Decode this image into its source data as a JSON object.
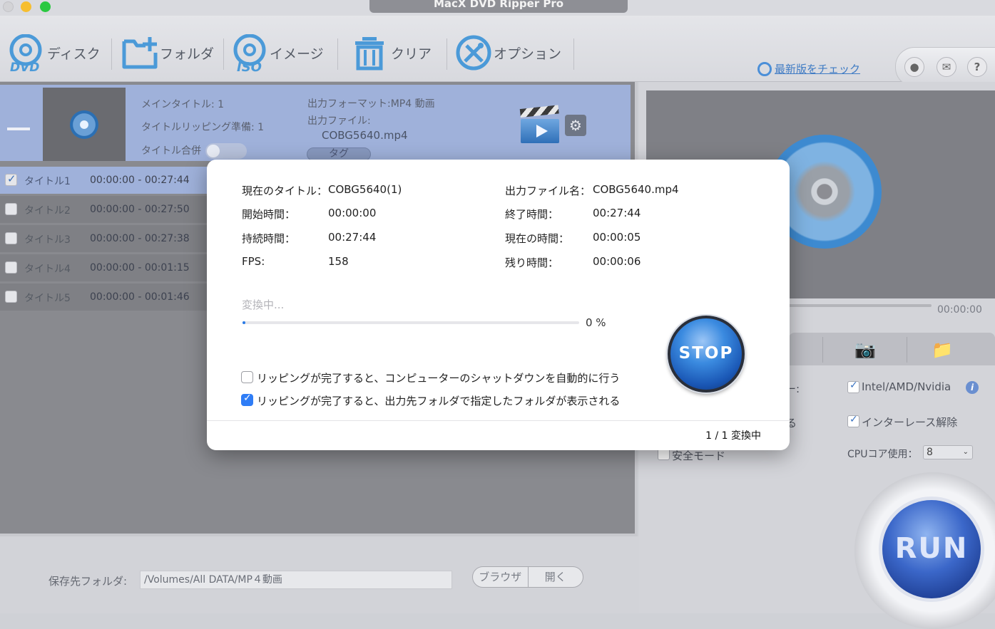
{
  "window": {
    "title": "MacX DVD Ripper Pro"
  },
  "toolbar": {
    "items": [
      {
        "label": "ディスク",
        "icon": "dvd-disc-icon"
      },
      {
        "label": "フォルダ",
        "icon": "add-folder-icon"
      },
      {
        "label": "イメージ",
        "icon": "iso-image-icon"
      },
      {
        "label": "クリア",
        "icon": "trash-icon"
      },
      {
        "label": "オプション",
        "icon": "wrench-screwdriver-icon"
      }
    ],
    "update_link": "最新版をチェック",
    "round_buttons": [
      "user-icon",
      "mail-icon",
      "help-icon"
    ],
    "accent": "#4b9ad8"
  },
  "source": {
    "main_title": "メインタイトル: 1",
    "ready_titles": "タイトルリッピング準備: 1",
    "merge_label": "タイトル合併",
    "output_format": "出力フォーマット:MP4 動画",
    "output_file_label": "出力ファイル:",
    "output_file": "COBG5640.mp4",
    "tag_button": "タグ"
  },
  "titles": [
    {
      "name": "タイトル1",
      "range": "00:00:00 - 00:27:44",
      "checked": true
    },
    {
      "name": "タイトル2",
      "range": "00:00:00 - 00:27:50",
      "checked": false
    },
    {
      "name": "タイトル3",
      "range": "00:00:00 - 00:27:38",
      "checked": false
    },
    {
      "name": "タイトル4",
      "range": "00:00:00 - 00:01:15",
      "checked": false
    },
    {
      "name": "タイトル5",
      "range": "00:00:00 - 00:01:46",
      "checked": false
    }
  ],
  "preview": {
    "timecode": "00:00:00"
  },
  "options": {
    "hw_suffix": "ー:",
    "hw_accel": "Intel/AMD/Nvidia",
    "opt2_suffix": "る",
    "deinterlace": "インターレース解除",
    "safe_mode": "安全モード",
    "cpu_label": "CPUコア使用：",
    "cpu_value": "8"
  },
  "run_button": "RUN",
  "bottom": {
    "save_label": "保存先フォルダ:",
    "save_path": "/Volumes/All DATA/MP４動画",
    "browse": "ブラウザ",
    "open": "開く"
  },
  "modal": {
    "current_title_label": "現在のタイトル：",
    "current_title": "COBG5640(1)",
    "output_name_label": "出力ファイル名：",
    "output_name": "COBG5640.mp4",
    "start_label": "開始時間：",
    "start": "00:00:00",
    "end_label": "終了時間：",
    "end": "00:27:44",
    "duration_label": "持続時間：",
    "duration": "00:27:44",
    "now_label": "現在の時間：",
    "now": "00:00:05",
    "fps_label": "FPS:",
    "fps": "158",
    "remain_label": "残り時間：",
    "remain": "00:00:06",
    "converting": "変換中...",
    "progress_percent": 0,
    "progress_text": "0 %",
    "stop": "STOP",
    "shutdown_option": "リッピングが完了すると、コンピューターのシャットダウンを自動的に行う",
    "shutdown_checked": false,
    "open_folder_option": "リッピングが完了すると、出力先フォルダで指定したフォルダが表示される",
    "open_folder_checked": true,
    "status": "1 / 1 変換中"
  }
}
